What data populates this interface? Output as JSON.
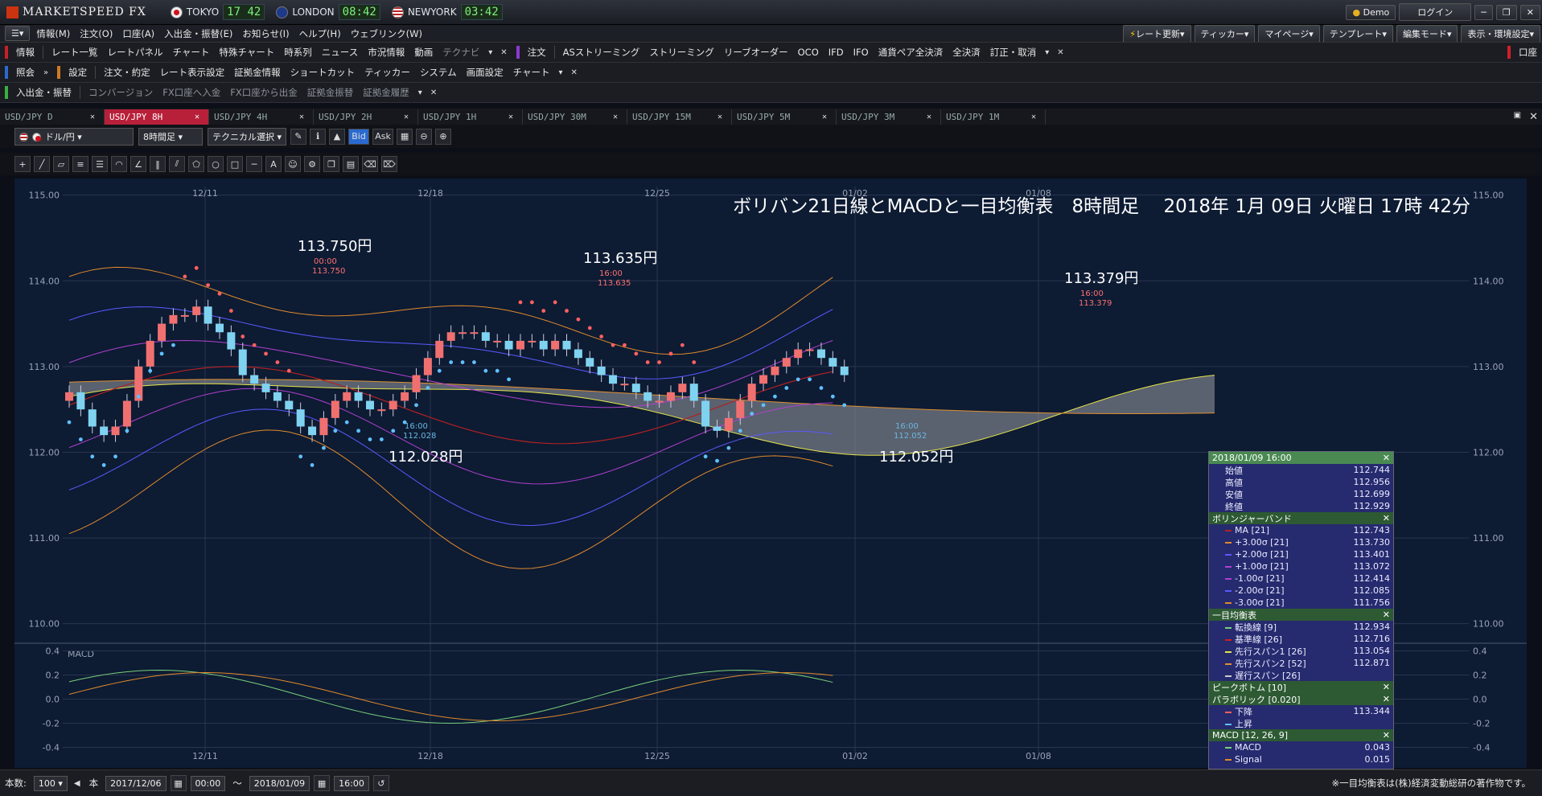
{
  "app": {
    "brand": "MARKETSPEED FX",
    "clocks": [
      {
        "city": "TOKYO",
        "time": "17 42"
      },
      {
        "city": "LONDON",
        "time": "08:42"
      },
      {
        "city": "NEWYORK",
        "time": "03:42"
      }
    ],
    "demo": "Demo",
    "login": "ログイン"
  },
  "menu": [
    "情報(M)",
    "注文(O)",
    "口座(A)",
    "入出金・振替(E)",
    "お知らせ(I)",
    "ヘルプ(H)",
    "ウェブリンク(W)"
  ],
  "menu_right": [
    "レート更新",
    "ティッカー",
    "マイページ",
    "テンプレート",
    "編集モード",
    "表示・環境設定"
  ],
  "tb1_left": {
    "group": "情報",
    "items": [
      "レート一覧",
      "レートパネル",
      "チャート",
      "特殊チャート",
      "時系列",
      "ニュース",
      "市況情報",
      "動画",
      "テクナビ"
    ]
  },
  "tb1_right": {
    "group": "注文",
    "items": [
      "ASストリーミング",
      "ストリーミング",
      "リーブオーダー",
      "OCO",
      "IFD",
      "IFO",
      "通貨ペア全決済",
      "全決済",
      "訂正・取消"
    ]
  },
  "tb1_far": "口座",
  "tb2": {
    "group1": "照会",
    "group2": "設定",
    "items": [
      "注文・約定",
      "レート表示設定",
      "証拠金情報",
      "ショートカット",
      "ティッカー",
      "システム",
      "画面設定",
      "チャート"
    ]
  },
  "tb3": {
    "group": "入出金・振替",
    "items": [
      "コンバージョン",
      "FX口座へ入金",
      "FX口座から出金",
      "証拠金振替",
      "証拠金履歴"
    ]
  },
  "tabs": [
    "USD/JPY D",
    "USD/JPY 8H",
    "USD/JPY 4H",
    "USD/JPY 2H",
    "USD/JPY 1H",
    "USD/JPY 30M",
    "USD/JPY 15M",
    "USD/JPY 5M",
    "USD/JPY 3M",
    "USD/JPY 1M"
  ],
  "active_tab": "USD/JPY 8H",
  "toolbar": {
    "pair": "ドル/円",
    "period": "8時間足",
    "tech": "テクニカル選択",
    "bid": "Bid",
    "ask": "Ask"
  },
  "status": {
    "count_label": "本数:",
    "count": "100",
    "unit": "本",
    "from_date": "2017/12/06",
    "from_time": "00:00",
    "tilde": "〜",
    "to_date": "2018/01/09",
    "to_time": "16:00",
    "note": "※一目均衡表は(株)経済変動総研の著作物です。"
  },
  "info": {
    "header": "2018/01/09 16:00",
    "ohlc": [
      [
        "始値",
        "112.744"
      ],
      [
        "高値",
        "112.956"
      ],
      [
        "安値",
        "112.699"
      ],
      [
        "終値",
        "112.929"
      ]
    ],
    "boll_title": "ボリンジャーバンド",
    "boll": [
      [
        "MA [21]",
        "112.743",
        "#b22222"
      ],
      [
        "+3.00σ [21]",
        "113.730",
        "#e08a2c"
      ],
      [
        "+2.00σ [21]",
        "113.401",
        "#5a5aff"
      ],
      [
        "+1.00σ [21]",
        "113.072",
        "#b040d0"
      ],
      [
        "-1.00σ [21]",
        "112.414",
        "#b040d0"
      ],
      [
        "-2.00σ [21]",
        "112.085",
        "#5a5aff"
      ],
      [
        "-3.00σ [21]",
        "111.756",
        "#e08a2c"
      ]
    ],
    "ichi_title": "一目均衡表",
    "ichi": [
      [
        "転換線 [9]",
        "112.934",
        "#7ad07a"
      ],
      [
        "基準線 [26]",
        "112.716",
        "#d02020"
      ],
      [
        "先行スパン1 [26]",
        "113.054",
        "#e6e64a"
      ],
      [
        "先行スパン2 [52]",
        "112.871",
        "#e09030"
      ],
      [
        "遅行スパン [26]",
        "",
        "#cccccc"
      ]
    ],
    "peak_title": "ピークボトム [10]",
    "para_title": "パラボリック [0.020]",
    "para": [
      [
        "下降",
        "113.344",
        "#ff6060"
      ],
      [
        "上昇",
        "",
        "#60c0ff"
      ]
    ],
    "macd_title": "MACD [12, 26, 9]",
    "macd": [
      [
        "MACD",
        "0.043",
        "#7ad07a"
      ],
      [
        "Signal",
        "0.015",
        "#e08a2c"
      ]
    ]
  },
  "chart_data": {
    "type": "candlestick",
    "title": "ボリバン21日線とMACDと一目均衡表　8時間足　 2018年 1月 09日 火曜日 17時 42分",
    "y_ticks": [
      "115.00",
      "114.00",
      "113.00",
      "112.00",
      "111.00",
      "110.00"
    ],
    "ylim": [
      109.8,
      115.1
    ],
    "x_ticks": [
      "12/11",
      "12/18",
      "12/25",
      "01/02",
      "01/08"
    ],
    "macd_ticks": [
      "0.4",
      "0.2",
      "0.0",
      "-0.2",
      "-0.4"
    ],
    "macd_label": "MACD",
    "annotations": [
      {
        "big": "113.750円",
        "time": "00:00",
        "price": "113.750"
      },
      {
        "big": "113.635円",
        "time": "16:00",
        "price": "113.635"
      },
      {
        "big": "113.379円",
        "time": "16:00",
        "price": "113.379"
      },
      {
        "big": "112.028円",
        "time": "16:00",
        "price": "112.028"
      },
      {
        "big": "112.052円",
        "time": "16:00",
        "price": "112.052"
      }
    ]
  }
}
